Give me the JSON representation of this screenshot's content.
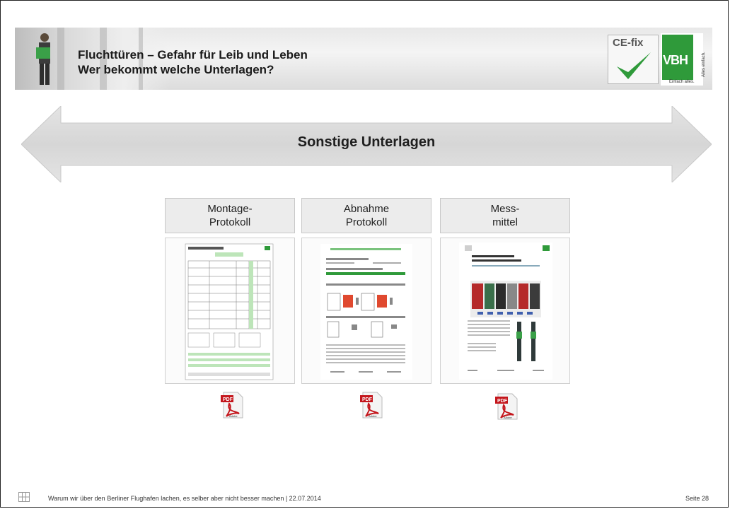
{
  "header": {
    "title_line1": "Fluchttüren – Gefahr für Leib und Leben",
    "title_line2": "Wer bekommt welche Unterlagen?",
    "logo_cefix": "CE-fix",
    "logo_vbh": "VBH",
    "logo_vbh_side": "Alles einfach.",
    "logo_vbh_bottom": "Einfach alles."
  },
  "arrow": {
    "label": "Sonstige Unterlagen",
    "color": "#d9d9d9"
  },
  "documents": [
    {
      "title_line1": "Montage-",
      "title_line2": "Protokoll",
      "file_icon": "pdf-adobe-icon"
    },
    {
      "title_line1": "Abnahme",
      "title_line2": "Protokoll",
      "file_icon": "pdf-adobe-icon"
    },
    {
      "title_line1": "Mess-",
      "title_line2": "mittel",
      "file_icon": "pdf-adobe-icon"
    }
  ],
  "footer": {
    "text": "Warum wir über den Berliner Flughafen lachen, es selber aber nicht besser machen | 22.07.2014",
    "page": "Seite 28"
  },
  "colors": {
    "accent_green": "#2f9a3a",
    "pdf_red": "#c4161c"
  }
}
